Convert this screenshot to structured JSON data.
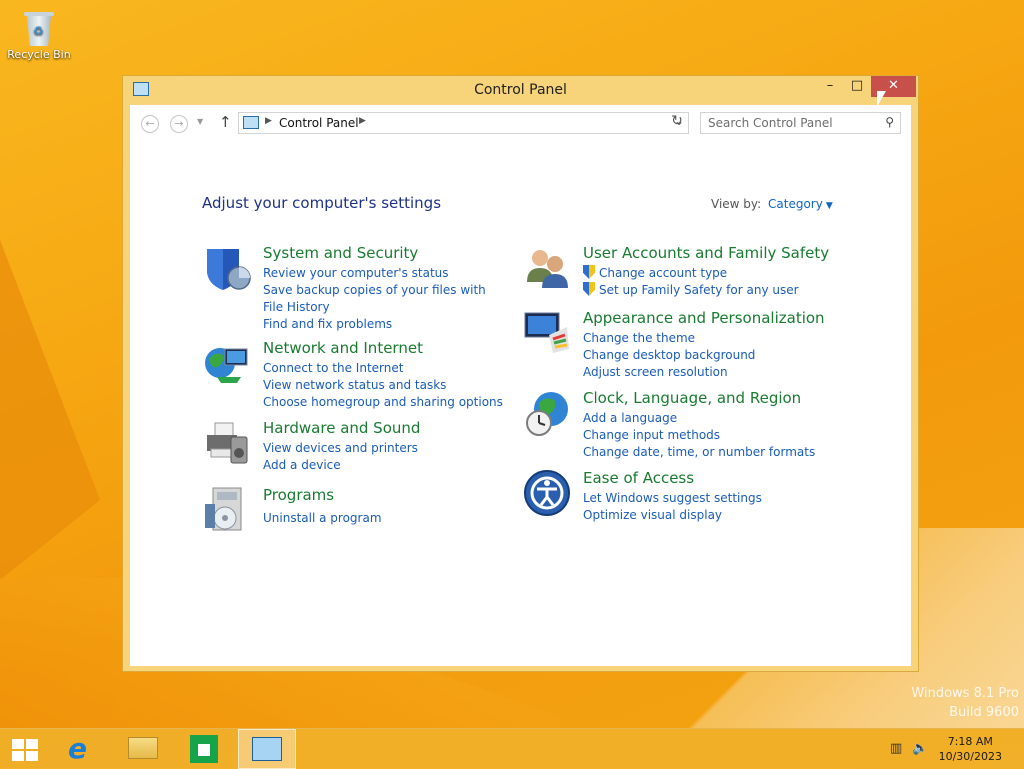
{
  "desktop": {
    "recycle_bin_label": "Recycle Bin",
    "watermark_line1": "Windows 8.1 Pro",
    "watermark_line2": "Build 9600"
  },
  "window": {
    "title": "Control Panel",
    "minimize_glyph": "–",
    "maximize_glyph": "□",
    "close_glyph": "✕"
  },
  "address_bar": {
    "back_icon": "back-arrow-icon",
    "forward_icon": "forward-arrow-icon",
    "up_glyph": "↑",
    "breadcrumb": "Control Panel",
    "search_placeholder": "Search Control Panel"
  },
  "main": {
    "heading": "Adjust your computer's settings",
    "view_by_label": "View by:",
    "view_by_value": "Category"
  },
  "categories_left": [
    {
      "title": "System and Security",
      "icon": "shield-icon",
      "links": [
        "Review your computer's status",
        "Save backup copies of your files with File History",
        "Find and fix problems"
      ]
    },
    {
      "title": "Network and Internet",
      "icon": "globe-network-icon",
      "links": [
        "Connect to the Internet",
        "View network status and tasks",
        "Choose homegroup and sharing options"
      ]
    },
    {
      "title": "Hardware and Sound",
      "icon": "printer-icon",
      "links": [
        "View devices and printers",
        "Add a device"
      ]
    },
    {
      "title": "Programs",
      "icon": "programs-icon",
      "links": [
        "Uninstall a program"
      ]
    }
  ],
  "categories_right": [
    {
      "title": "User Accounts and Family Safety",
      "icon": "users-icon",
      "links": [
        "Change account type",
        "Set up Family Safety for any user"
      ]
    },
    {
      "title": "Appearance and Personalization",
      "icon": "monitor-palette-icon",
      "links": [
        "Change the theme",
        "Change desktop background",
        "Adjust screen resolution"
      ]
    },
    {
      "title": "Clock, Language, and Region",
      "icon": "globe-clock-icon",
      "links": [
        "Add a language",
        "Change input methods",
        "Change date, time, or number formats"
      ]
    },
    {
      "title": "Ease of Access",
      "icon": "ease-of-access-icon",
      "links": [
        "Let Windows suggest settings",
        "Optimize visual display"
      ]
    }
  ],
  "taskbar": {
    "time": "7:18 AM",
    "date": "10/30/2023"
  },
  "colors": {
    "category_title": "#197b30",
    "link": "#1a5cb8",
    "heading": "#1e3287",
    "window_frame": "#f7d379",
    "close_button": "#c7504a"
  }
}
